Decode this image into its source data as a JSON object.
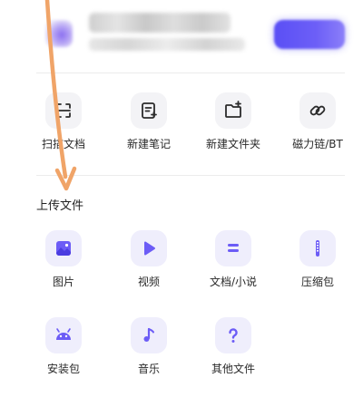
{
  "header": {
    "avatar_icon": "user-avatar-blurred",
    "name": "",
    "subtitle": "",
    "vip_label": "",
    "vip_color": "#5a4ff5"
  },
  "quick_actions": [
    {
      "label": "扫描文档",
      "icon": "scan-icon"
    },
    {
      "label": "新建笔记",
      "icon": "note-add-icon"
    },
    {
      "label": "新建文件夹",
      "icon": "folder-add-icon"
    },
    {
      "label": "磁力链/BT",
      "icon": "link-icon"
    }
  ],
  "upload": {
    "title": "上传文件",
    "items": [
      {
        "label": "图片",
        "icon": "image-icon"
      },
      {
        "label": "视频",
        "icon": "video-icon"
      },
      {
        "label": "文档/小说",
        "icon": "document-icon"
      },
      {
        "label": "压缩包",
        "icon": "zip-icon"
      },
      {
        "label": "安装包",
        "icon": "android-icon"
      },
      {
        "label": "音乐",
        "icon": "music-icon"
      },
      {
        "label": "其他文件",
        "icon": "question-icon"
      }
    ]
  },
  "colors": {
    "accent": "#6c5cf6",
    "annotation_arrow": "#f0a468"
  }
}
